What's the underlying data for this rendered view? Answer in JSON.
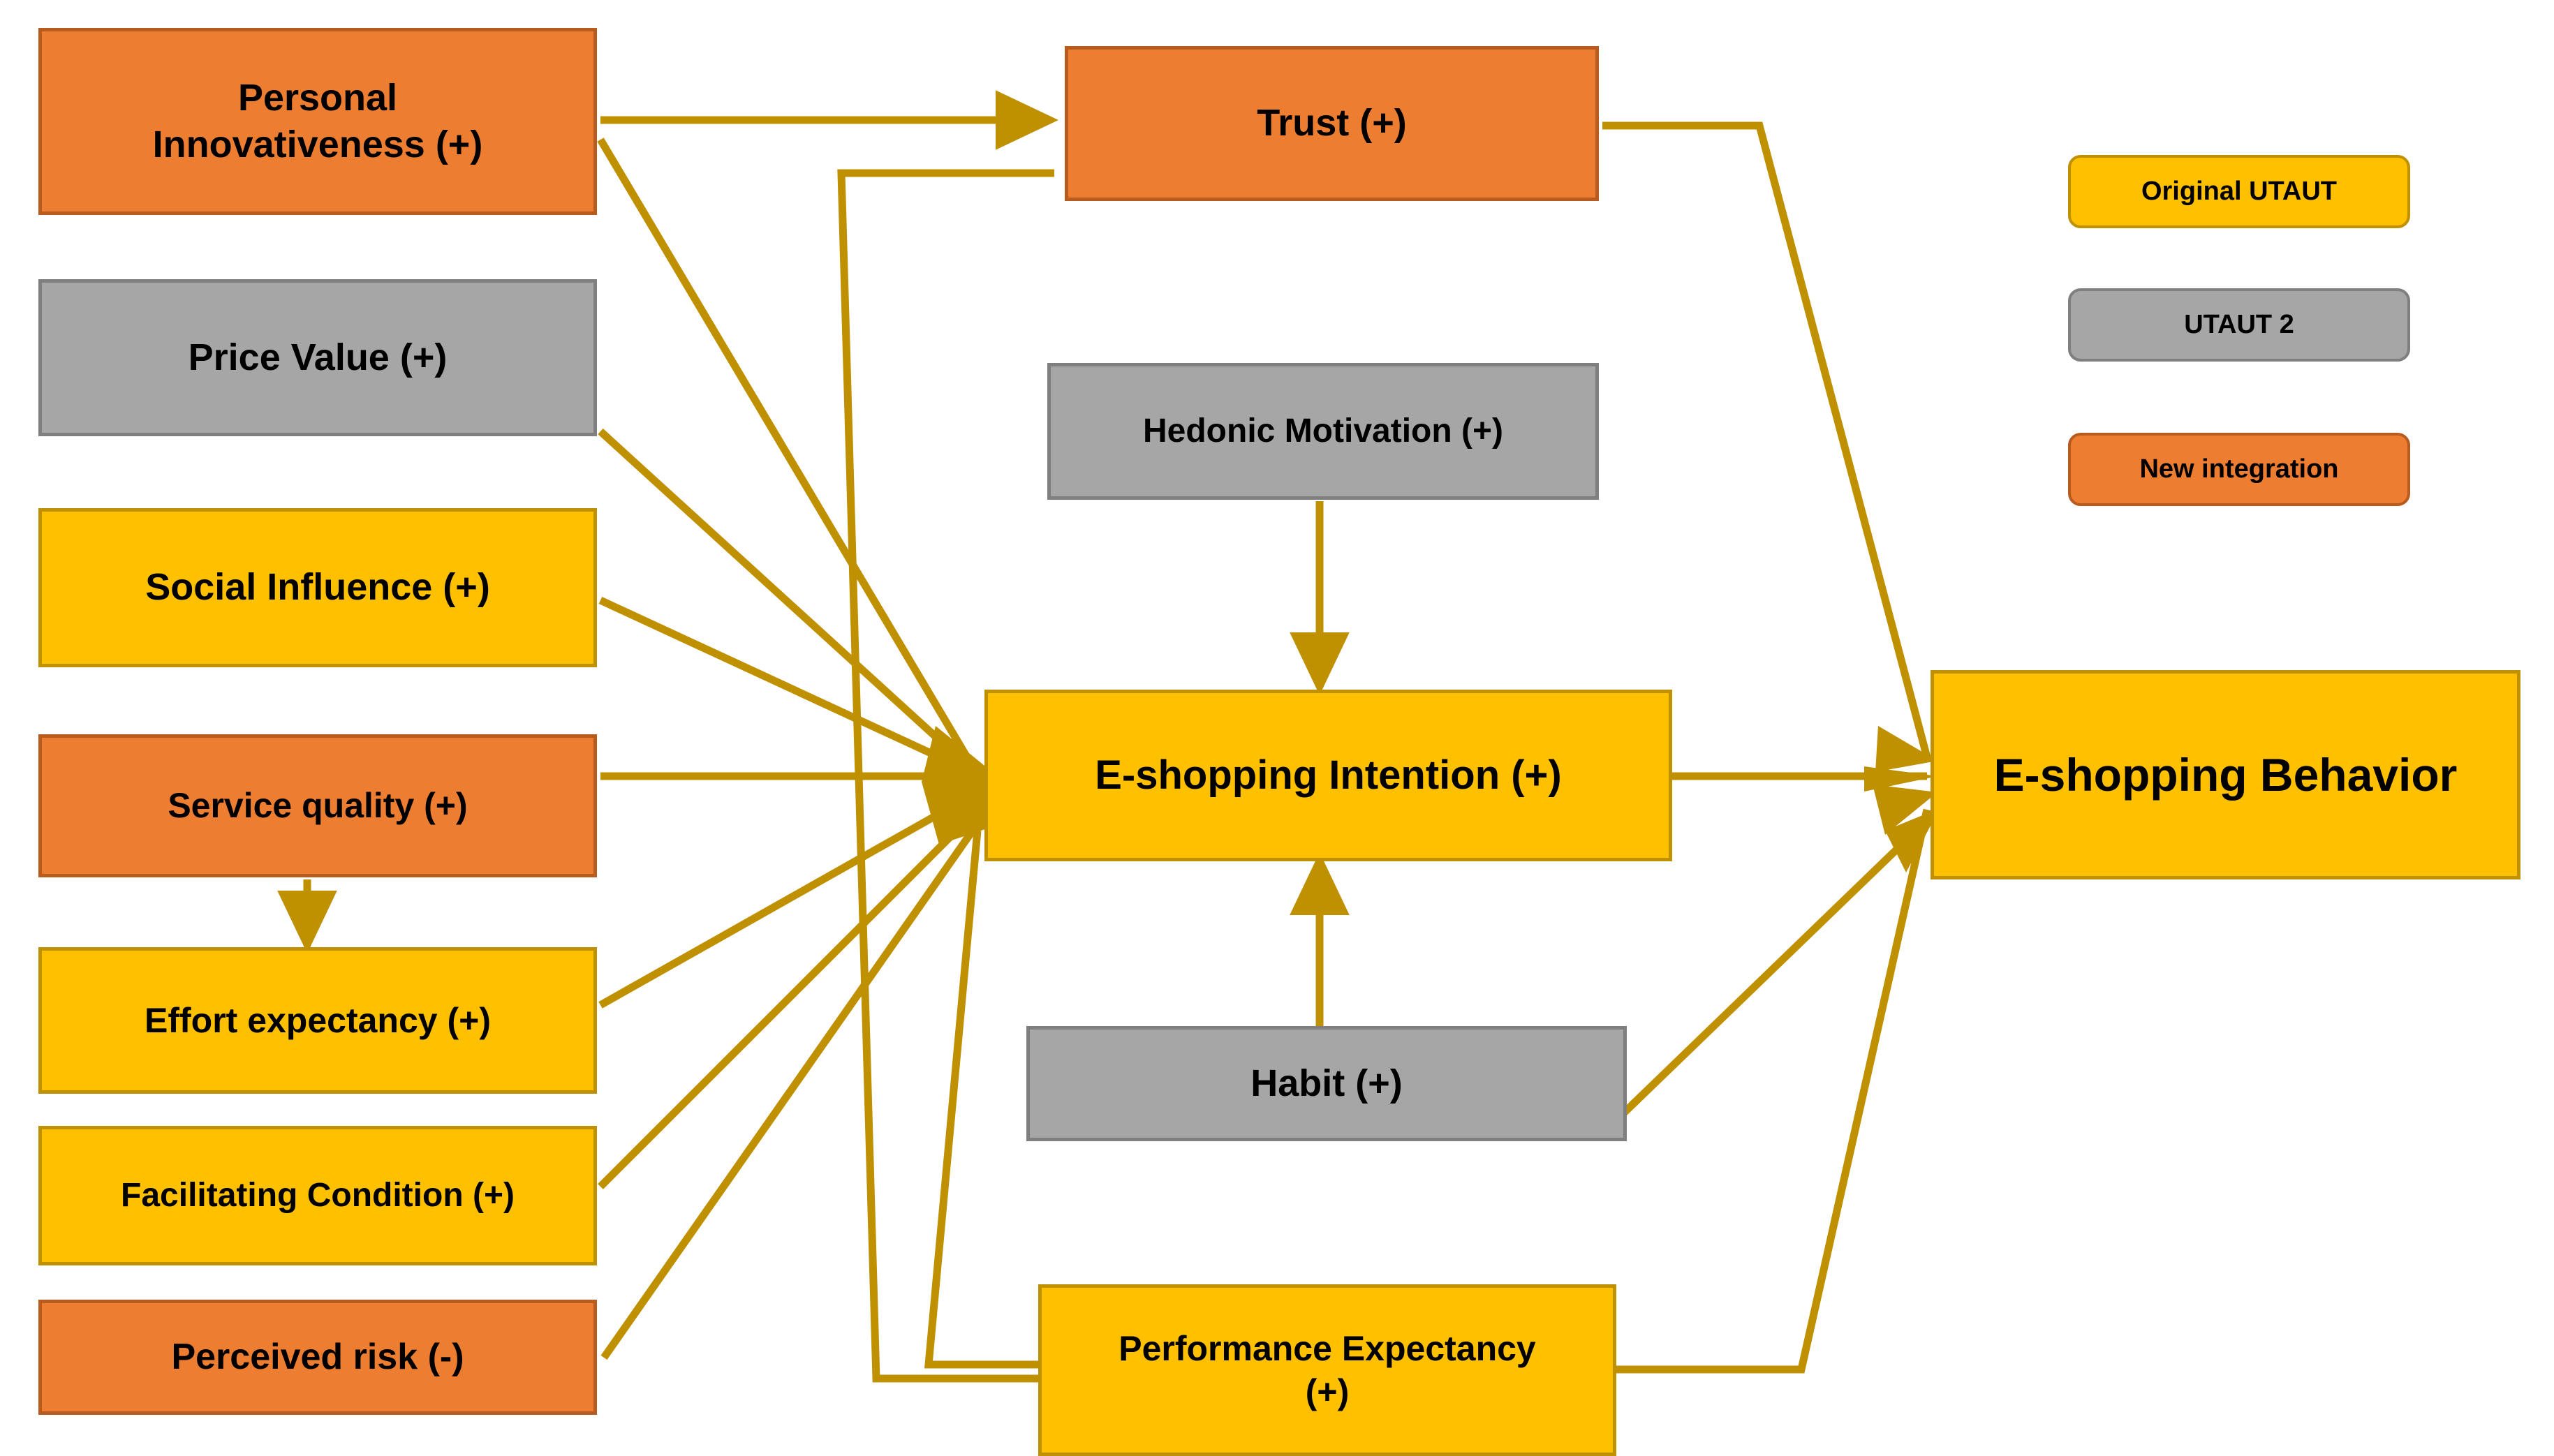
{
  "diagram": {
    "title": "UTAUT / UTAUT2 extended e-shopping research model",
    "colors": {
      "original_utaut": "#FFC000",
      "utaut_2": "#A6A6A6",
      "new_integration": "#ED7D31",
      "edge": "#BF9000",
      "border_yellow": "#BF9000",
      "border_gray": "#7F7F7F",
      "border_orange": "#B85B1E",
      "background": "#FFFFFF",
      "text": "#000000"
    }
  },
  "nodes": {
    "personal_innovativeness": {
      "label": "Personal\nInnovativeness (+)",
      "line1": "Personal",
      "line2": "Innovativeness (+)",
      "category": "New integration",
      "sign": "+"
    },
    "price_value": {
      "label": "Price Value  (+)",
      "category": "UTAUT 2",
      "sign": "+"
    },
    "social_influence": {
      "label": "Social Influence (+)",
      "category": "Original UTAUT",
      "sign": "+"
    },
    "service_quality": {
      "label": "Service quality (+)",
      "category": "New integration",
      "sign": "+"
    },
    "effort_expectancy": {
      "label": "Effort expectancy (+)",
      "category": "Original UTAUT",
      "sign": "+"
    },
    "facilitating_condition": {
      "label": "Facilitating  Condition  (+)",
      "category": "Original UTAUT",
      "sign": "+"
    },
    "perceived_risk": {
      "label": "Perceived risk (-)",
      "category": "New integration",
      "sign": "-"
    },
    "trust": {
      "label": "Trust (+)",
      "category": "New integration",
      "sign": "+"
    },
    "hedonic_motivation": {
      "label": "Hedonic  Motivation  (+)",
      "category": "UTAUT 2",
      "sign": "+"
    },
    "eshopping_intention": {
      "label": "E-shopping Intention (+)",
      "category": "Original UTAUT",
      "sign": "+"
    },
    "habit": {
      "label": "Habit (+)",
      "category": "UTAUT 2",
      "sign": "+"
    },
    "performance_expectancy": {
      "label": "Performance Expectancy\n(+)",
      "line1": "Performance Expectancy",
      "line2": "(+)",
      "category": "Original UTAUT",
      "sign": "+"
    },
    "eshopping_behavior": {
      "label": "E-shopping Behavior",
      "category": "Original UTAUT",
      "sign": ""
    }
  },
  "legend": {
    "items": [
      {
        "label": "Original UTAUT",
        "color": "#FFC000",
        "style": "yellow"
      },
      {
        "label": "UTAUT 2",
        "color": "#A6A6A6",
        "style": "gray"
      },
      {
        "label": "New integration",
        "color": "#ED7D31",
        "style": "orange"
      }
    ]
  },
  "edges": [
    {
      "from": "personal_innovativeness",
      "to": "trust",
      "arrow": true
    },
    {
      "from": "personal_innovativeness",
      "to": "eshopping_intention",
      "arrow": true
    },
    {
      "from": "price_value",
      "to": "eshopping_intention",
      "arrow": true
    },
    {
      "from": "social_influence",
      "to": "eshopping_intention",
      "arrow": true
    },
    {
      "from": "service_quality",
      "to": "eshopping_intention",
      "arrow": true
    },
    {
      "from": "service_quality",
      "to": "effort_expectancy",
      "arrow": true
    },
    {
      "from": "effort_expectancy",
      "to": "eshopping_intention",
      "arrow": true
    },
    {
      "from": "facilitating_condition",
      "to": "eshopping_intention",
      "arrow": true
    },
    {
      "from": "perceived_risk",
      "to": "eshopping_intention",
      "arrow": true
    },
    {
      "from": "performance_expectancy",
      "to": "trust",
      "arrow": true
    },
    {
      "from": "performance_expectancy",
      "to": "eshopping_intention",
      "arrow": true
    },
    {
      "from": "performance_expectancy",
      "to": "eshopping_behavior",
      "arrow": true
    },
    {
      "from": "hedonic_motivation",
      "to": "eshopping_intention",
      "arrow": true
    },
    {
      "from": "habit",
      "to": "eshopping_intention",
      "arrow": true
    },
    {
      "from": "habit",
      "to": "eshopping_behavior",
      "arrow": true
    },
    {
      "from": "trust",
      "to": "eshopping_behavior",
      "arrow": true
    },
    {
      "from": "eshopping_intention",
      "to": "eshopping_behavior",
      "arrow": true
    }
  ]
}
